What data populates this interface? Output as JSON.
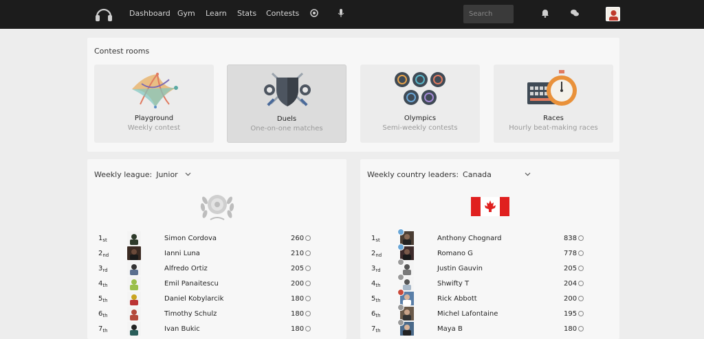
{
  "nav": {
    "items": [
      "Dashboard",
      "Gym",
      "Learn",
      "Stats",
      "Contests"
    ],
    "search_placeholder": "Search",
    "icons": [
      "headphones-logo-icon",
      "record-icon",
      "microphone-icon",
      "bell-icon",
      "chat-icon"
    ]
  },
  "rooms": {
    "title": "Contest rooms",
    "cards": [
      {
        "name": "Playground",
        "subtitle": "Weekly contest",
        "icon": "playground-icon"
      },
      {
        "name": "Duels",
        "subtitle": "One-on-one matches",
        "icon": "shield-swords-icon"
      },
      {
        "name": "Olympics",
        "subtitle": "Semi-weekly contests",
        "icon": "olympic-rings-icon"
      },
      {
        "name": "Races",
        "subtitle": "Hourly beat-making races",
        "icon": "stopwatch-icon"
      }
    ]
  },
  "league": {
    "label": "Weekly league:",
    "selected": "Junior",
    "badge_icon": "laurel-medal-icon",
    "rows": [
      {
        "rank": "1",
        "suffix": "st",
        "name": "Simon Cordova",
        "score": "260",
        "avatar_color": "#2d3a2a"
      },
      {
        "rank": "2",
        "suffix": "nd",
        "name": "Ianni Luna",
        "score": "210",
        "avatar_color": "#3a2a22"
      },
      {
        "rank": "3",
        "suffix": "rd",
        "name": "Alfredo Ortiz",
        "score": "205",
        "avatar_color": "#5a6f8f"
      },
      {
        "rank": "4",
        "suffix": "th",
        "name": "Emil Panaitescu",
        "score": "200",
        "avatar_color": "#9abf4a"
      },
      {
        "rank": "5",
        "suffix": "th",
        "name": "Daniel Kobylarcik",
        "score": "180",
        "avatar_color": "#c9a41f"
      },
      {
        "rank": "6",
        "suffix": "th",
        "name": "Timothy Schulz",
        "score": "180",
        "avatar_color": "#b44a3b"
      },
      {
        "rank": "7",
        "suffix": "th",
        "name": "Ivan Bukic",
        "score": "180",
        "avatar_color": "#2a5e5a"
      }
    ]
  },
  "country": {
    "label": "Weekly country leaders:",
    "selected": "Canada",
    "flag_icon": "canada-flag-icon",
    "rows": [
      {
        "rank": "1",
        "suffix": "st",
        "name": "Anthony Chognard",
        "score": "838",
        "avatar_color": "#4a3d33"
      },
      {
        "rank": "2",
        "suffix": "nd",
        "name": "Romano G",
        "score": "778",
        "avatar_color": "#3d2b2b"
      },
      {
        "rank": "3",
        "suffix": "rd",
        "name": "Justin Gauvin",
        "score": "205",
        "avatar_color": "#7a7a7a"
      },
      {
        "rank": "4",
        "suffix": "th",
        "name": "Shwifty T",
        "score": "204",
        "avatar_color": "#a8b8c8"
      },
      {
        "rank": "5",
        "suffix": "th",
        "name": "Rick Abbott",
        "score": "200",
        "avatar_color": "#5a7fa8"
      },
      {
        "rank": "6",
        "suffix": "th",
        "name": "Michel Lafontaine",
        "score": "195",
        "avatar_color": "#6a5a4a"
      },
      {
        "rank": "7",
        "suffix": "th",
        "name": "Maya B",
        "score": "180",
        "avatar_color": "#4a6a8a"
      }
    ]
  }
}
